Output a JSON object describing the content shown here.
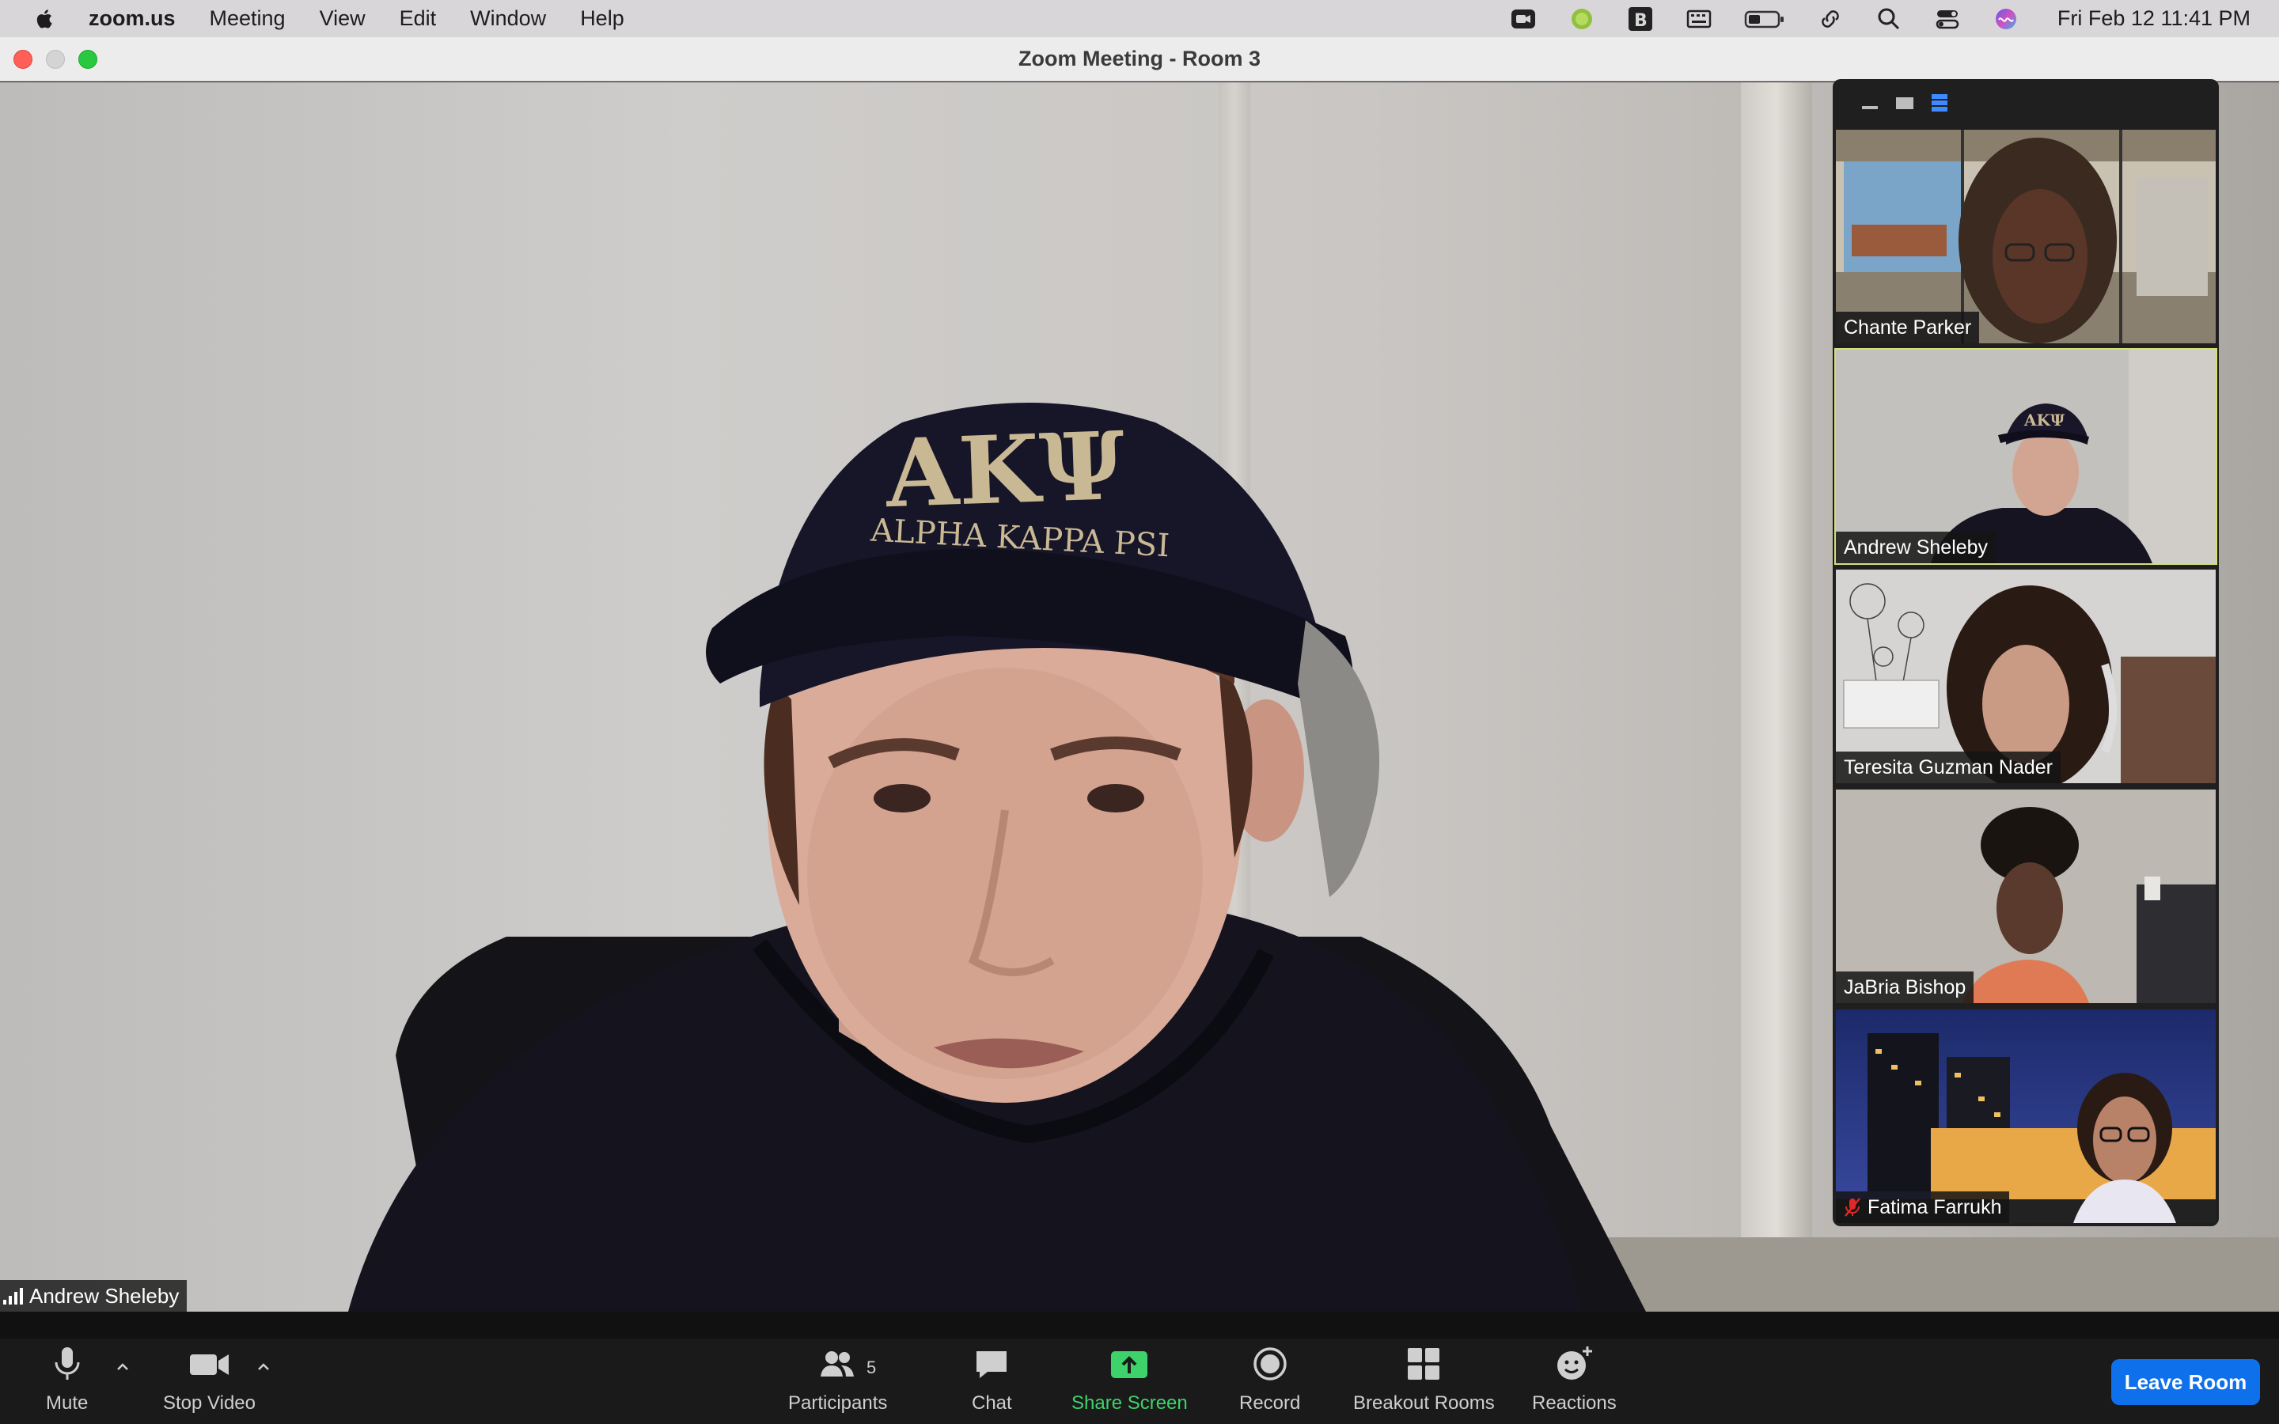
{
  "menubar": {
    "app": "zoom.us",
    "menus": [
      "Meeting",
      "View",
      "Edit",
      "Window",
      "Help"
    ],
    "status_icons": [
      "zoom-camera-icon",
      "green-dot-icon",
      "bold-b-icon",
      "keyboard-icon",
      "battery-icon",
      "link-icon",
      "search-icon",
      "control-center-icon",
      "siri-icon"
    ],
    "clock": "Fri Feb 12  11:41 PM"
  },
  "window": {
    "title": "Zoom Meeting - Room 3"
  },
  "main_video": {
    "speaker": "Andrew Sheleby"
  },
  "participants": [
    {
      "name": "Chante Parker",
      "active": false,
      "muted": false
    },
    {
      "name": "Andrew Sheleby",
      "active": true,
      "muted": false
    },
    {
      "name": "Teresita Guzman Nader",
      "active": false,
      "muted": false
    },
    {
      "name": "JaBria Bishop",
      "active": false,
      "muted": false
    },
    {
      "name": "Fatima Farrukh",
      "active": false,
      "muted": true
    }
  ],
  "toolbar": {
    "mute": "Mute",
    "stop_video": "Stop Video",
    "participants": "Participants",
    "participants_count": "5",
    "chat": "Chat",
    "share_screen": "Share Screen",
    "record": "Record",
    "breakout_rooms": "Breakout Rooms",
    "reactions": "Reactions",
    "leave": "Leave Room"
  },
  "colors": {
    "share_green": "#3ed36a",
    "leave_blue": "#0e71eb",
    "active_speaker_border": "#d4e07a",
    "muted_red": "#e02828"
  }
}
